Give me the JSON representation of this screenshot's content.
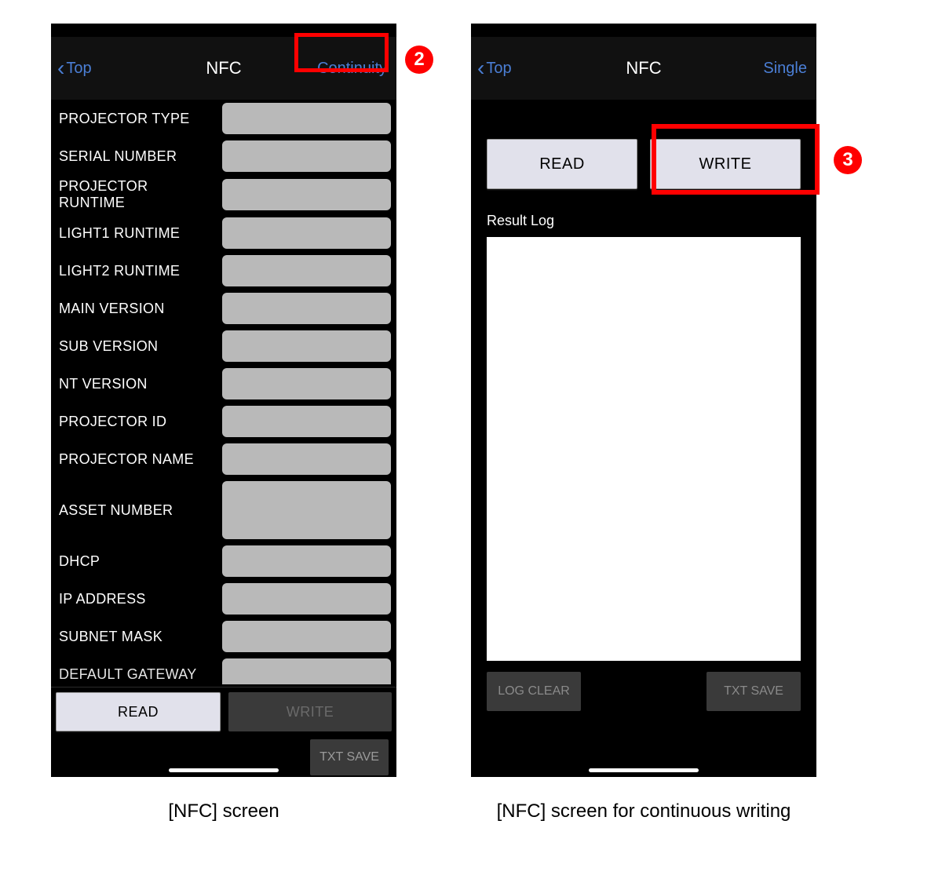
{
  "screens": {
    "left": {
      "nav": {
        "back": "Top",
        "title": "NFC",
        "right": "Continuity"
      },
      "fields": [
        {
          "label": "PROJECTOR TYPE"
        },
        {
          "label": "SERIAL NUMBER"
        },
        {
          "label": "PROJECTOR RUNTIME"
        },
        {
          "label": "LIGHT1 RUNTIME"
        },
        {
          "label": "LIGHT2 RUNTIME"
        },
        {
          "label": "MAIN VERSION"
        },
        {
          "label": "SUB VERSION"
        },
        {
          "label": "NT VERSION"
        },
        {
          "label": "PROJECTOR ID"
        },
        {
          "label": "PROJECTOR NAME"
        },
        {
          "label": "ASSET NUMBER",
          "tall": true
        },
        {
          "label": "DHCP"
        },
        {
          "label": "IP ADDRESS"
        },
        {
          "label": "SUBNET MASK"
        },
        {
          "label": "DEFAULT GATEWAY",
          "partial": true
        }
      ],
      "buttons": {
        "read": "READ",
        "write": "WRITE",
        "txt_save": "TXT SAVE"
      }
    },
    "right": {
      "nav": {
        "back": "Top",
        "title": "NFC",
        "right": "Single"
      },
      "buttons": {
        "read": "READ",
        "write": "WRITE",
        "log_clear": "LOG CLEAR",
        "txt_save": "TXT SAVE"
      },
      "result_label": "Result Log"
    }
  },
  "captions": {
    "left": "[NFC] screen",
    "right": "[NFC] screen for continuous writing"
  },
  "callouts": {
    "num2": "2",
    "num3": "3"
  }
}
